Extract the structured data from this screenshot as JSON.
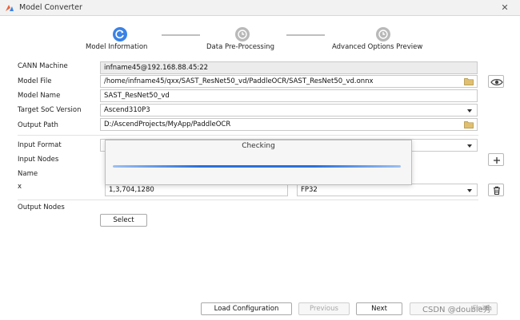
{
  "window": {
    "title": "Model Converter",
    "close_glyph": "✕"
  },
  "steps": [
    {
      "label": "Model Information",
      "state": "active"
    },
    {
      "label": "Data Pre-Processing",
      "state": "inactive"
    },
    {
      "label": "Advanced Options  Preview",
      "state": "inactive"
    }
  ],
  "form": {
    "cann_machine": {
      "label": "CANN Machine",
      "value": "infname45@192.168.88.45:22"
    },
    "model_file": {
      "label": "Model File",
      "value": "/home/infname45/qxx/SAST_ResNet50_vd/PaddleOCR/SAST_ResNet50_vd.onnx"
    },
    "model_name": {
      "label": "Model Name",
      "value": "SAST_ResNet50_vd"
    },
    "target_soc": {
      "label": "Target SoC Version",
      "value": "Ascend310P3"
    },
    "output_path": {
      "label": "Output Path",
      "value": "D:/AscendProjects/MyApp/PaddleOCR"
    },
    "input_format": {
      "label": "Input Format",
      "value": ""
    },
    "input_nodes": {
      "label": "Input Nodes"
    },
    "name": {
      "label": "Name"
    },
    "node_row": {
      "label": "x",
      "shape": "1,3,704,1280",
      "type": "FP32"
    },
    "output_nodes": {
      "label": "Output Nodes",
      "select_label": "Select"
    }
  },
  "dialog": {
    "title": "Checking",
    "progress": 1.0
  },
  "footer": {
    "load_config": "Load Configuration",
    "previous": "Previous",
    "next": "Next",
    "finish": "Finish"
  },
  "watermark": "CSDN @double秀",
  "colors": {
    "accent": "#3a82e6",
    "inactive": "#b9b9b9"
  },
  "icons": {
    "app": "app-logo-icon",
    "close": "close-icon",
    "folder": "folder-icon",
    "dropdown": "chevron-down-icon",
    "view": "eye-icon",
    "add": "plus-icon",
    "delete": "trash-icon",
    "step": "clock-icon"
  }
}
